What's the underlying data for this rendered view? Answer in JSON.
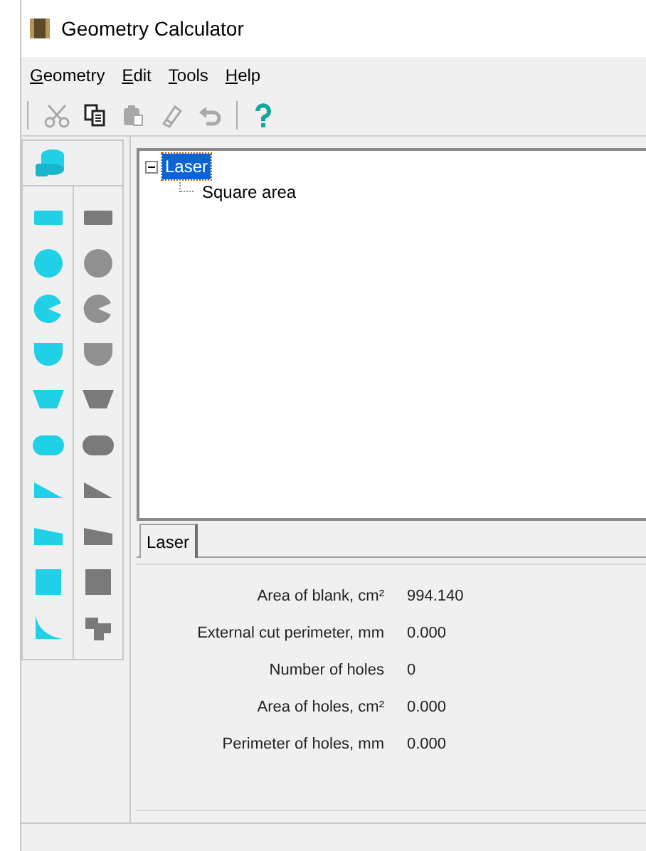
{
  "window": {
    "title": "Geometry Calculator"
  },
  "menu": [
    {
      "label": "Geometry"
    },
    {
      "label": "Edit"
    },
    {
      "label": "Tools"
    },
    {
      "label": "Help"
    }
  ],
  "toolbar": [
    {
      "kind": "cut",
      "disabled": true
    },
    {
      "kind": "copy",
      "disabled": false
    },
    {
      "kind": "paste",
      "disabled": true
    },
    {
      "kind": "eraser",
      "disabled": true
    },
    {
      "kind": "undo",
      "disabled": true
    },
    {
      "kind": "help",
      "disabled": false
    }
  ],
  "palette": [
    {
      "left": {
        "kind": "rectangle",
        "color": "#1fd0e6"
      },
      "right": {
        "kind": "rectangle",
        "color": "#7a7a7a"
      }
    },
    {
      "left": {
        "kind": "circle",
        "color": "#1fd0e6"
      },
      "right": {
        "kind": "circle",
        "color": "#909090"
      }
    },
    {
      "left": {
        "kind": "pie",
        "color": "#1fd0e6"
      },
      "right": {
        "kind": "pie",
        "color": "#909090"
      }
    },
    {
      "left": {
        "kind": "half-disc",
        "color": "#1fd0e6"
      },
      "right": {
        "kind": "half-disc",
        "color": "#909090"
      }
    },
    {
      "left": {
        "kind": "trapezoid",
        "color": "#1fd0e6"
      },
      "right": {
        "kind": "trapezoid",
        "color": "#7a7a7a"
      }
    },
    {
      "left": {
        "kind": "stadium",
        "color": "#1fd0e6"
      },
      "right": {
        "kind": "stadium",
        "color": "#7a7a7a"
      }
    },
    {
      "left": {
        "kind": "triangle",
        "color": "#1fd0e6"
      },
      "right": {
        "kind": "triangle",
        "color": "#7a7a7a"
      }
    },
    {
      "left": {
        "kind": "quad",
        "color": "#1fd0e6"
      },
      "right": {
        "kind": "quad",
        "color": "#7a7a7a"
      }
    },
    {
      "left": {
        "kind": "square",
        "color": "#1fd0e6"
      },
      "right": {
        "kind": "square",
        "color": "#7a7a7a"
      }
    },
    {
      "left": {
        "kind": "fillet",
        "color": "#1fd0e6"
      },
      "right": {
        "kind": "puzzle",
        "color": "#7a7a7a"
      }
    }
  ],
  "tree": [
    {
      "label": "Laser",
      "selected": true,
      "expanded": true,
      "children": [
        {
          "label": "Square area",
          "selected": false
        }
      ]
    }
  ],
  "tabs": [
    {
      "label": "Laser",
      "selected": true
    }
  ],
  "results": [
    {
      "label": "Area of blank, cm²",
      "value": "994.140"
    },
    {
      "label": "External cut perimeter, mm",
      "value": "0.000"
    },
    {
      "label": "Number of holes",
      "value": "0"
    },
    {
      "label": "Area of holes, cm²",
      "value": "0.000"
    },
    {
      "label": "Perimeter of holes, mm",
      "value": "0.000"
    }
  ]
}
